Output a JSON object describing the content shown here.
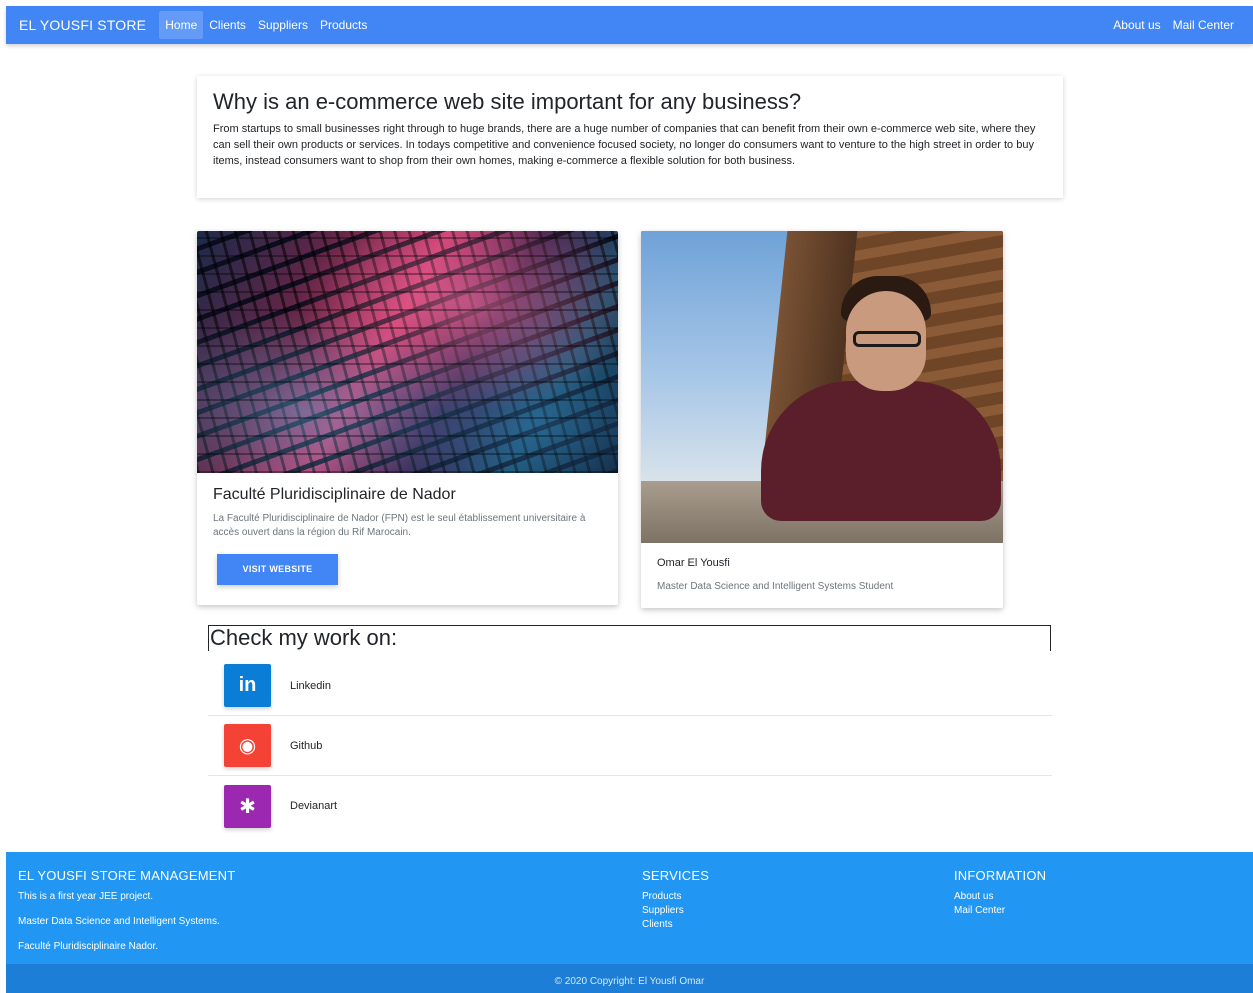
{
  "navbar": {
    "brand": "EL YOUSFI STORE",
    "links": [
      "Home",
      "Clients",
      "Suppliers",
      "Products"
    ],
    "right_links": [
      "About us",
      "Mail Center"
    ],
    "accent_color": "#4285f4"
  },
  "intro": {
    "title": "Why is an e-commerce web site important for any business?",
    "body": "From startups to small businesses right through to huge brands, there are a huge number of companies that can benefit from their own e-commerce web site, where they can sell their own products or services. In todays competitive and convenience focused society, no longer do consumers want to venture to the high street in order to buy items, instead consumers want to shop from their own homes, making e-commerce a flexible solution for both business."
  },
  "fpn_card": {
    "image": "building-facade-image",
    "title": "Faculté Pluridisciplinaire de Nador",
    "text": "La Faculté Pluridisciplinaire de Nador (FPN) est le seul établissement universitaire à accès ouvert dans la région du Rif Marocain.",
    "button": "VISIT WEBSITE"
  },
  "profile_card": {
    "image": "portrait-photo",
    "name": "Omar El Yousfi",
    "role": "Master Data Science and Intelligent Systems Student"
  },
  "social": {
    "title": "Check my work on:",
    "items": [
      {
        "label": "Linkedin",
        "icon": "linkedin-icon",
        "glyph": "in",
        "color": "#0a7ed6"
      },
      {
        "label": "Github",
        "icon": "github-icon",
        "glyph": "◉",
        "color": "#f44336"
      },
      {
        "label": "Devianart",
        "icon": "deviantart-icon",
        "glyph": "✱",
        "color": "#9c27b0"
      }
    ]
  },
  "footer": {
    "col1_title": "EL YOUSFI STORE MANAGEMENT",
    "col1_lines": [
      "This is a first year JEE project.",
      "Master Data Science and Intelligent Systems.",
      "Faculté Pluridisciplinaire Nador."
    ],
    "col2_title": "SERVICES",
    "col2_links": [
      "Products",
      "Suppliers",
      "Clients"
    ],
    "col3_title": "INFORMATION",
    "col3_links": [
      "About us",
      "Mail Center"
    ],
    "copyright": "© 2020 Copyright: El Yousfi Omar",
    "color": "#2196f3"
  }
}
